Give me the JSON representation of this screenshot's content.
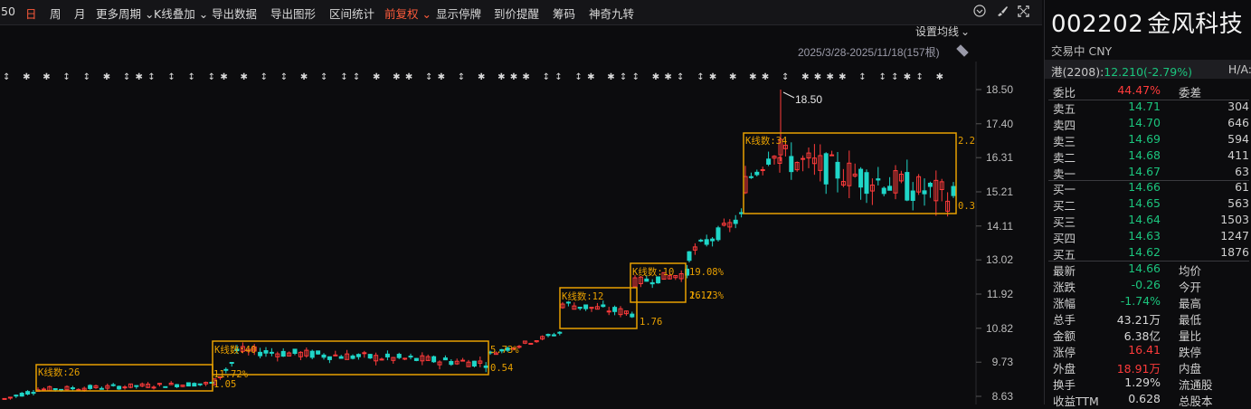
{
  "toolbar": {
    "items": [
      "50",
      "日",
      "周",
      "月",
      "更多周期",
      "K线叠加",
      "导出数据",
      "导出图形",
      "区间统计",
      "前复权",
      "显示停牌",
      "到价提醒",
      "筹码",
      "神奇九转"
    ],
    "active_index": 1,
    "chevron": "⌄",
    "icons": [
      "chevron-circle-icon",
      "brush-icon",
      "pin-icon",
      "expand-icon"
    ]
  },
  "chart": {
    "setting_ma": "设置均线",
    "range_label": "2025/3/28-2025/11/18(157根)",
    "y_ticks": [
      "18.50",
      "17.40",
      "16.31",
      "15.21",
      "14.11",
      "13.02",
      "11.92",
      "10.82",
      "9.73",
      "8.63"
    ],
    "high_marker": "18.50",
    "marker_symbols": "↕ ✱ ✱ ↕ ↕ ✱ ↕✱↕ ↕ ↕ ↕✱ ✱ ↕ ↕ ✱ ↕ ↕↕ ✱ ✱✱ ↕✱ ↕ ✱ ✱✱✱ ↕↕ ↕✱ ✱↕↕ ✱✱↕ ↕✱ ✱ ✱✱ ↕ ✱✱✱✱ ↕ ↕↕✱↕ ✱",
    "boxes": [
      {
        "label": "K线数:26",
        "pct": "11.72%",
        "amp": "1.05"
      },
      {
        "label": "K线数:40",
        "pct": "5.73%",
        "amp": "0.54"
      },
      {
        "label": "K线数:12",
        "pct": "1.76",
        "amp": ""
      },
      {
        "label": "K线数:10",
        "pct": "16.73%",
        "amp": "2.12"
      },
      {
        "label": "",
        "pct": "19.08%",
        "amp": ""
      },
      {
        "label": "K线数:34",
        "pct": "2.2",
        "amp": "0.3"
      }
    ]
  },
  "panel": {
    "code": "002202",
    "name": "金风科技",
    "status": "交易中 CNY",
    "hk_label": "港(2208):",
    "hk_value": "12.210(-2.79%)",
    "ha_label": "H/A:",
    "webi": {
      "label": "委比",
      "value": "44.47%",
      "label2": "委差"
    },
    "asks": [
      {
        "label": "卖五",
        "price": "14.71",
        "vol": "304"
      },
      {
        "label": "卖四",
        "price": "14.70",
        "vol": "646"
      },
      {
        "label": "卖三",
        "price": "14.69",
        "vol": "594"
      },
      {
        "label": "卖二",
        "price": "14.68",
        "vol": "411"
      },
      {
        "label": "卖一",
        "price": "14.67",
        "vol": "63"
      }
    ],
    "bids": [
      {
        "label": "买一",
        "price": "14.66",
        "vol": "61"
      },
      {
        "label": "买二",
        "price": "14.65",
        "vol": "563"
      },
      {
        "label": "买三",
        "price": "14.64",
        "vol": "1503"
      },
      {
        "label": "买四",
        "price": "14.63",
        "vol": "1247"
      },
      {
        "label": "买五",
        "price": "14.62",
        "vol": "1876"
      }
    ],
    "stats": [
      {
        "label": "最新",
        "value": "14.66",
        "color": "green",
        "label2": "均价"
      },
      {
        "label": "涨跌",
        "value": "-0.26",
        "color": "green",
        "label2": "今开"
      },
      {
        "label": "涨幅",
        "value": "-1.74%",
        "color": "green",
        "label2": "最高"
      },
      {
        "label": "总手",
        "value": "43.21万",
        "color": "white",
        "label2": "最低"
      },
      {
        "label": "金额",
        "value": "6.38亿",
        "color": "white",
        "label2": "量比"
      },
      {
        "label": "涨停",
        "value": "16.41",
        "color": "red",
        "label2": "跌停"
      },
      {
        "label": "外盘",
        "value": "18.91万",
        "color": "red",
        "label2": "内盘"
      },
      {
        "label": "换手",
        "value": "1.29%",
        "color": "white",
        "label2": "流通股"
      },
      {
        "label": "收益TTM",
        "value": "0.628",
        "color": "white",
        "label2": "总股本"
      }
    ]
  },
  "colors": {
    "up": "#ff3b3b",
    "down": "#1fd6c8",
    "box": "#e8a000",
    "accent": "#ff5b3b"
  }
}
